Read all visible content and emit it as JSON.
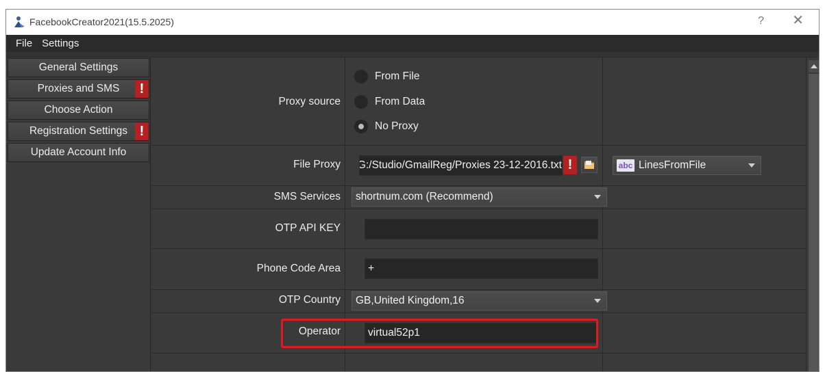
{
  "window": {
    "title": "FacebookCreator2021(15.5.2025)",
    "help": "?",
    "close": "✕"
  },
  "menu": {
    "items": [
      "File",
      "Settings"
    ]
  },
  "sidebar": {
    "items": [
      {
        "label": "General Settings",
        "warning": false
      },
      {
        "label": "Proxies and SMS",
        "warning": true
      },
      {
        "label": "Choose Action",
        "warning": false
      },
      {
        "label": "Registration Settings",
        "warning": true
      },
      {
        "label": "Update Account Info",
        "warning": false
      }
    ],
    "warning_glyph": "!"
  },
  "form": {
    "proxy_source": {
      "label": "Proxy source",
      "options": [
        "From File",
        "From Data",
        "No Proxy"
      ],
      "selected": "No Proxy"
    },
    "file_proxy": {
      "label": "File Proxy",
      "value": "G:/Studio/GmailReg/Proxies 23-12-2016.txt",
      "warning_glyph": "!",
      "mode": "LinesFromFile",
      "mode_icon_text": "abc"
    },
    "sms_services": {
      "label": "SMS Services",
      "value": "shortnum.com (Recommend)"
    },
    "otp_api_key": {
      "label": "OTP API KEY",
      "value": ""
    },
    "phone_code_area": {
      "label": "Phone Code Area",
      "value": "+"
    },
    "otp_country": {
      "label": "OTP Country",
      "value": "GB,United Kingdom,16"
    },
    "operator": {
      "label": "Operator",
      "value": "virtual52p1"
    }
  },
  "colors": {
    "window_bg": "#3a3a3a",
    "field_bg": "#262626",
    "warning": "#b32222",
    "highlight": "#e31a1a"
  }
}
